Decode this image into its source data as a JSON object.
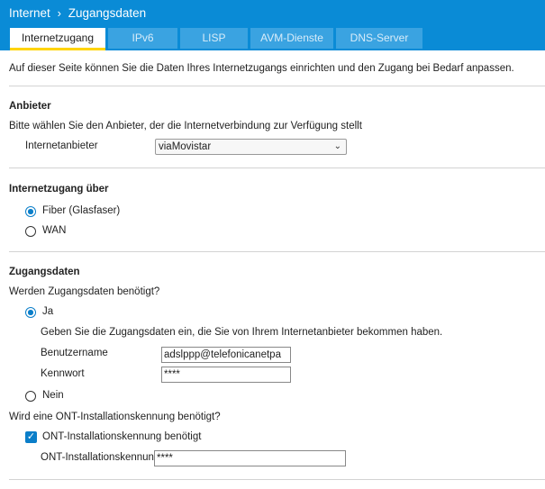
{
  "header": {
    "breadcrumb": {
      "root": "Internet",
      "separator": "›",
      "current": "Zugangsdaten"
    },
    "tabs": [
      {
        "label": "Internetzugang",
        "active": true
      },
      {
        "label": "IPv6",
        "active": false
      },
      {
        "label": "LISP",
        "active": false
      },
      {
        "label": "AVM-Dienste",
        "active": false
      },
      {
        "label": "DNS-Server",
        "active": false
      }
    ]
  },
  "intro": "Auf dieser Seite können Sie die Daten Ihres Internetzugangs einrichten und den Zugang bei Bedarf anpassen.",
  "anbieter": {
    "heading": "Anbieter",
    "description": "Bitte wählen Sie den Anbieter, der die Internetverbindung zur Verfügung stellt",
    "provider_label": "Internetanbieter",
    "provider_value": "viaMovistar"
  },
  "zugang": {
    "heading": "Internetzugang über",
    "options": [
      {
        "label": "Fiber (Glasfaser)",
        "selected": true
      },
      {
        "label": "WAN",
        "selected": false
      }
    ]
  },
  "zugangsdaten": {
    "heading": "Zugangsdaten",
    "question": "Werden Zugangsdaten benötigt?",
    "yes_label": "Ja",
    "yes_selected": true,
    "hint": "Geben Sie die Zugangsdaten ein, die Sie von Ihrem Internetanbieter bekommen haben.",
    "username_label": "Benutzername",
    "username_value": "adslppp@telefonicanetpa",
    "password_label": "Kennwort",
    "password_value": "****",
    "no_label": "Nein",
    "ont_question": "Wird eine ONT-Installationskennung benötigt?",
    "ont_checkbox_label": "ONT-Installationskennung benötigt",
    "ont_checked": true,
    "ont_field_label": "ONT-Installationskennung",
    "ont_value": "****"
  },
  "colors": {
    "header_bg": "#0a8bd6",
    "tab_bg": "#3aa3e1",
    "active_tab_underline": "#ffd400",
    "accent": "#0a7ec9"
  }
}
